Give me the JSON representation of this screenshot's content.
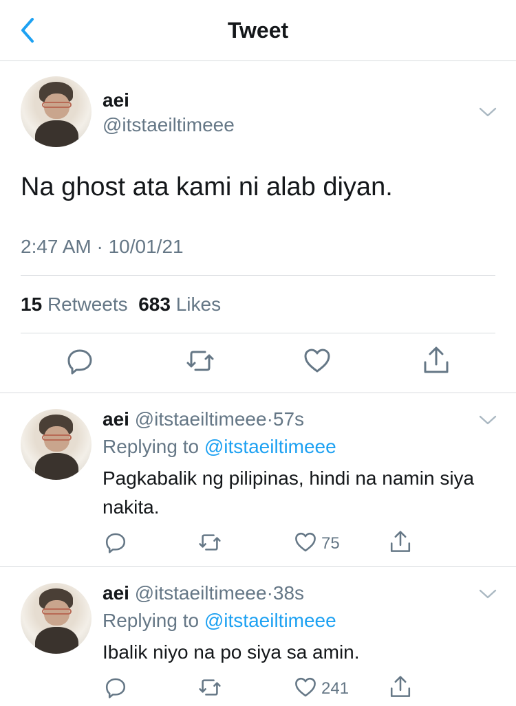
{
  "nav": {
    "title": "Tweet",
    "back_icon": "chevron-left-icon",
    "accent": "#1da1f2"
  },
  "main_tweet": {
    "name": "aei",
    "handle": "@itstaeiltimeee",
    "text": "Na ghost ata kami ni alab diyan.",
    "timestamp": "2:47 AM · 10/01/21",
    "retweets_count": "15",
    "retweets_label": "Retweets",
    "likes_count": "683",
    "likes_label": "Likes"
  },
  "replies": [
    {
      "name": "aei",
      "handle": "@itstaeiltimeee",
      "separator": "·",
      "time": "57s",
      "replying_prefix": "Replying to",
      "replying_to": "@itstaeiltimeee",
      "text": "Pagkabalik ng pilipinas, hindi na namin siya nakita.",
      "likes": "75"
    },
    {
      "name": "aei",
      "handle": "@itstaeiltimeee",
      "separator": "·",
      "time": "38s",
      "replying_prefix": "Replying to",
      "replying_to": "@itstaeiltimeee",
      "text": "Ibalik niyo na po siya sa amin.",
      "likes": "241"
    }
  ],
  "colors": {
    "text": "#14171a",
    "secondary": "#657786",
    "link": "#1da1f2",
    "divider": "#d7dbde"
  }
}
